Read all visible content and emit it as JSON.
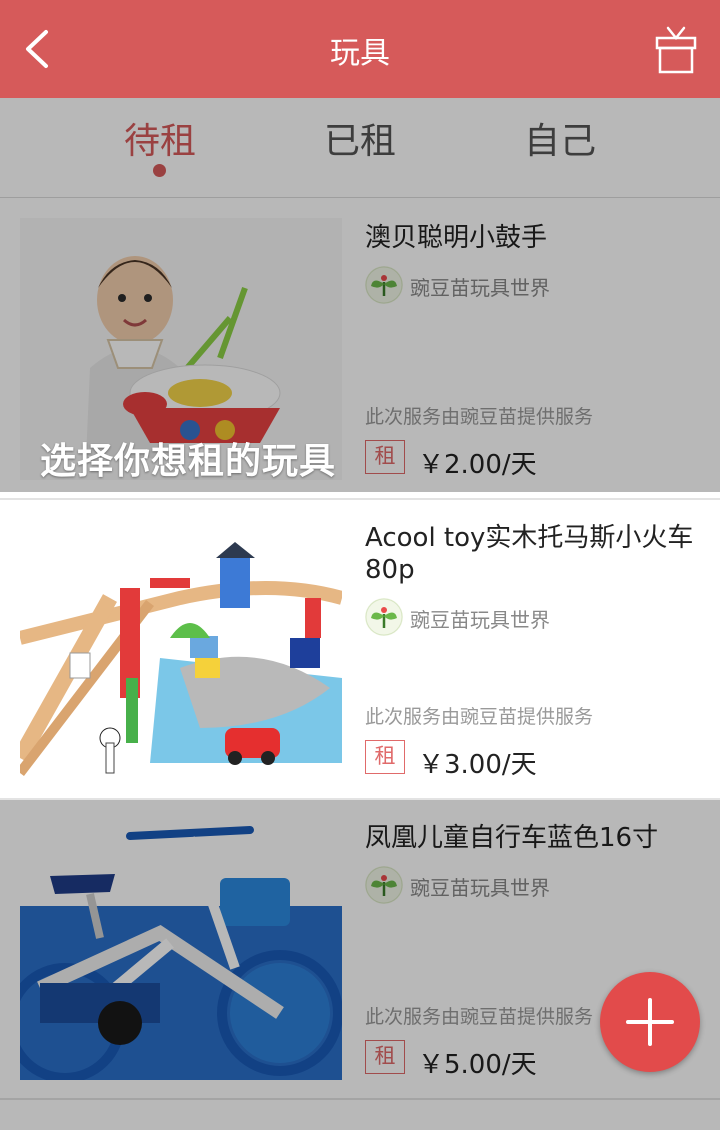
{
  "header": {
    "title": "玩具",
    "back_icon": "chevron-left-icon",
    "gift_icon": "gift-box-icon"
  },
  "tabs": [
    {
      "label": "待租",
      "active": true
    },
    {
      "label": "已租",
      "active": false
    },
    {
      "label": "自己",
      "active": false
    }
  ],
  "items": [
    {
      "title": "澳贝聪明小鼓手",
      "shop": "豌豆苗玩具世界",
      "service": "此次服务由豌豆苗提供服务",
      "tag": "租",
      "price": "￥2.00/天"
    },
    {
      "title": "Acool toy实木托马斯小火车80p",
      "shop": "豌豆苗玩具世界",
      "service": "此次服务由豌豆苗提供服务",
      "tag": "租",
      "price": "￥3.00/天"
    },
    {
      "title": "凤凰儿童自行车蓝色16寸",
      "shop": "豌豆苗玩具世界",
      "service": "此次服务由豌豆苗提供服务",
      "tag": "租",
      "price": "￥5.00/天"
    }
  ],
  "overlay": {
    "hint": "选择你想租的玩具"
  },
  "fab": {
    "icon": "plus-icon"
  },
  "colors": {
    "accent": "#d65a5a",
    "fab": "#e24b4b"
  }
}
